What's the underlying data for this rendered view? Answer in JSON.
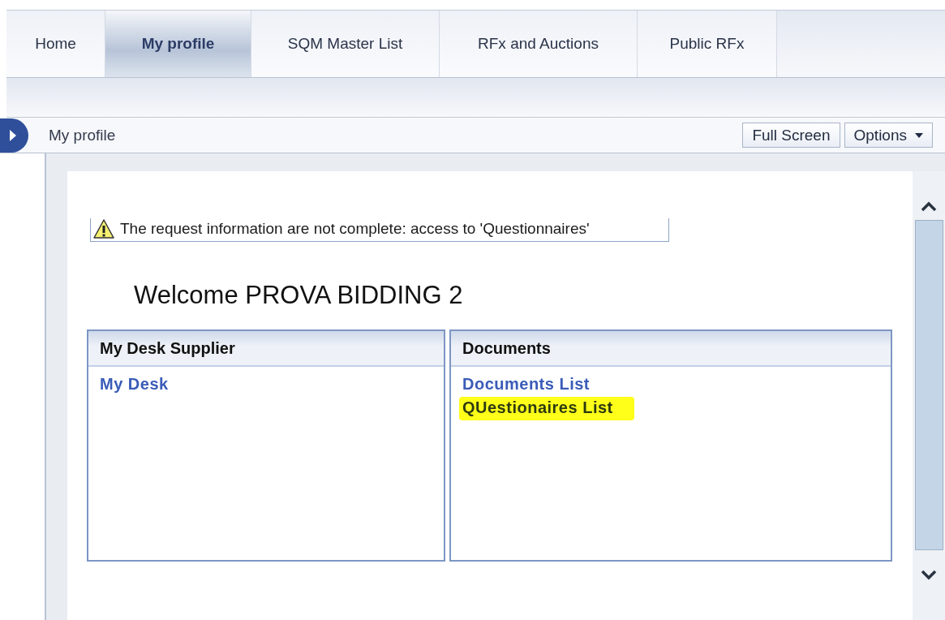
{
  "tabs": [
    {
      "label": "Home",
      "selected": false
    },
    {
      "label": "My profile",
      "selected": true
    },
    {
      "label": "SQM Master List",
      "selected": false
    },
    {
      "label": "RFx and Auctions",
      "selected": false
    },
    {
      "label": "Public RFx",
      "selected": false
    }
  ],
  "breadcrumb": "My profile",
  "toolbar_buttons": [
    {
      "label": "Full Screen",
      "kind": "plain"
    },
    {
      "label": "Options",
      "kind": "menu"
    }
  ],
  "warning": "The request information are not complete: access to 'Questionnaires'",
  "welcome": "Welcome PROVA BIDDING 2",
  "panels": [
    {
      "title": "My Desk Supplier",
      "links": [
        {
          "label": "My Desk",
          "highlighted": false
        }
      ]
    },
    {
      "title": "Documents",
      "links": [
        {
          "label": "Documents List",
          "highlighted": false
        },
        {
          "label": "QUestionaires List",
          "highlighted": true
        }
      ]
    }
  ]
}
